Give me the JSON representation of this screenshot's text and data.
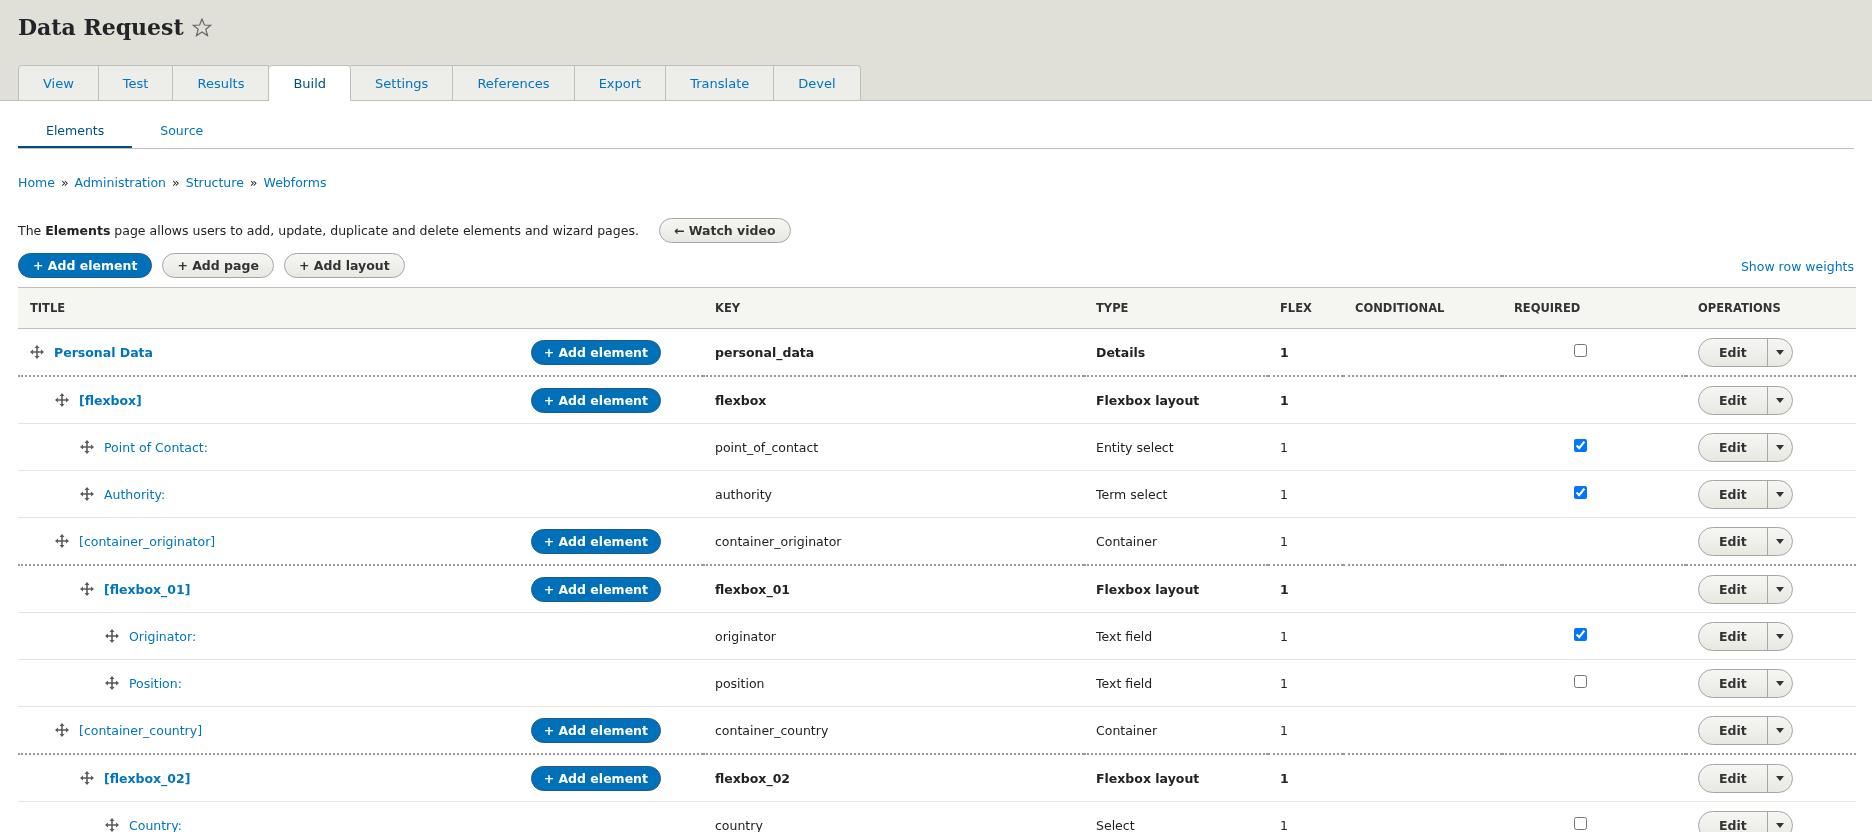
{
  "page_title": "Data Request",
  "tabs": [
    {
      "label": "View",
      "selected": false
    },
    {
      "label": "Test",
      "selected": false
    },
    {
      "label": "Results",
      "selected": false
    },
    {
      "label": "Build",
      "selected": true
    },
    {
      "label": "Settings",
      "selected": false
    },
    {
      "label": "References",
      "selected": false
    },
    {
      "label": "Export",
      "selected": false
    },
    {
      "label": "Translate",
      "selected": false
    },
    {
      "label": "Devel",
      "selected": false
    }
  ],
  "subtabs": [
    {
      "label": "Elements",
      "selected": true
    },
    {
      "label": "Source",
      "selected": false
    }
  ],
  "breadcrumb": [
    "Home",
    "Administration",
    "Structure",
    "Webforms"
  ],
  "breadcrumb_separator": "»",
  "description": "The **Elements** page allows users to add, update, duplicate and delete elements and wizard pages.",
  "watch_video": "← Watch video",
  "actions": [
    {
      "label": "+ Add element",
      "kind": "primary"
    },
    {
      "label": "+ Add page",
      "kind": "secondary"
    },
    {
      "label": "+ Add layout",
      "kind": "secondary"
    }
  ],
  "show_row_weights": "Show row weights",
  "table": {
    "columns": [
      "TITLE",
      "KEY",
      "TYPE",
      "FLEX",
      "CONDITIONAL",
      "REQUIRED",
      "OPERATIONS"
    ],
    "rows": [
      {
        "title": "Personal Data",
        "add_label": "+ Add element",
        "key": "personal_data",
        "type": "Details",
        "flex": "1",
        "kind": "details",
        "required": false,
        "edit_label": "Edit",
        "children": [
          {
            "title": "[flexbox]",
            "add_label": "+ Add element",
            "key": "flexbox",
            "type": "Flexbox layout",
            "flex": "1",
            "kind": "flexbox",
            "edit_label": "Edit",
            "children": [
              {
                "title": "Point of Contact:",
                "key": "point_of_contact",
                "type": "Entity select",
                "flex": "1",
                "kind": "element",
                "required": true,
                "edit_label": "Edit"
              },
              {
                "title": "Authority:",
                "key": "authority",
                "type": "Term select",
                "flex": "1",
                "kind": "element",
                "required": true,
                "edit_label": "Edit"
              }
            ]
          },
          {
            "title": "[container_originator]",
            "add_label": "+ Add element",
            "key": "container_originator",
            "type": "Container",
            "flex": "1",
            "kind": "container",
            "edit_label": "Edit",
            "children": [
              {
                "title": "[flexbox_01]",
                "add_label": "+ Add element",
                "key": "flexbox_01",
                "type": "Flexbox layout",
                "flex": "1",
                "kind": "flexbox",
                "edit_label": "Edit",
                "children": [
                  {
                    "title": "Originator:",
                    "key": "originator",
                    "type": "Text field",
                    "flex": "1",
                    "kind": "element",
                    "required": true,
                    "edit_label": "Edit"
                  },
                  {
                    "title": "Position:",
                    "key": "position",
                    "type": "Text field",
                    "flex": "1",
                    "kind": "element",
                    "required": false,
                    "edit_label": "Edit"
                  }
                ]
              }
            ]
          },
          {
            "title": "[container_country]",
            "add_label": "+ Add element",
            "key": "container_country",
            "type": "Container",
            "flex": "1",
            "kind": "container",
            "edit_label": "Edit",
            "children": [
              {
                "title": "[flexbox_02]",
                "add_label": "+ Add element",
                "key": "flexbox_02",
                "type": "Flexbox layout",
                "flex": "1",
                "kind": "flexbox",
                "edit_label": "Edit",
                "children": [
                  {
                    "title": "Country:",
                    "key": "country",
                    "type": "Select",
                    "flex": "1",
                    "kind": "element",
                    "required": false,
                    "edit_label": "Edit"
                  }
                ]
              }
            ]
          }
        ]
      }
    ]
  }
}
